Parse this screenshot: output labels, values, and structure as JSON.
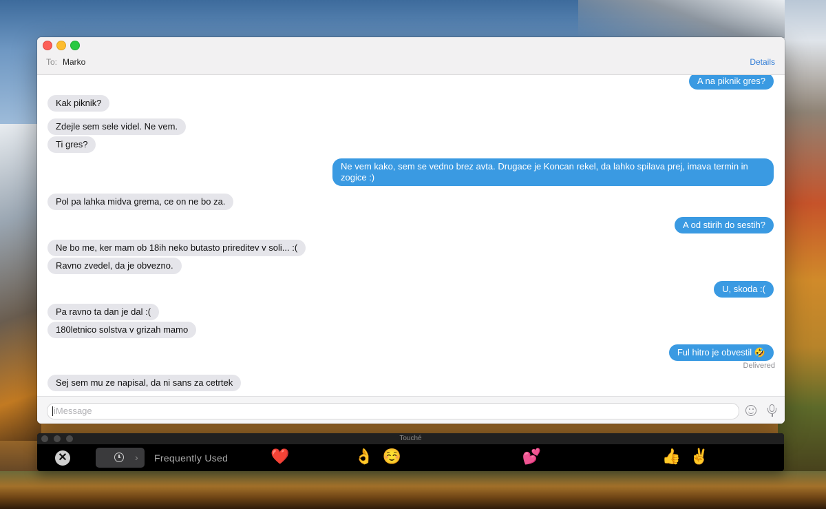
{
  "messages_window": {
    "to_label": "To:",
    "recipient": "Marko",
    "details_label": "Details",
    "composer_placeholder": "iMessage"
  },
  "conversation": [
    {
      "dir": "out",
      "text": "A na piknik gres?"
    },
    {
      "dir": "in",
      "text": "Kak piknik?"
    },
    {
      "dir": "in",
      "text": "Zdejle sem sele videl. Ne vem."
    },
    {
      "dir": "in",
      "text": "Ti gres?"
    },
    {
      "dir": "out",
      "text": "Ne vem kako, sem se vedno brez avta. Drugace je Koncan rekel, da lahko spilava prej, imava termin in zogice :)"
    },
    {
      "dir": "in",
      "text": "Pol pa lahka midva grema, ce on ne bo za."
    },
    {
      "dir": "out",
      "text": "A od stirih do sestih?"
    },
    {
      "dir": "in",
      "text": "Ne bo me, ker mam ob 18ih neko butasto prireditev v soli... :("
    },
    {
      "dir": "in",
      "text": "Ravno zvedel, da je obvezno."
    },
    {
      "dir": "out",
      "text": "U, skoda :("
    },
    {
      "dir": "in",
      "text": "Pa ravno ta dan je dal :("
    },
    {
      "dir": "in",
      "text": "180letnico solstva v grizah mamo"
    },
    {
      "dir": "out",
      "text": "Ful hitro je obvestil 🤣"
    },
    {
      "dir": "in",
      "text": "Sej sem mu ze napisal, da ni sans za cetrtek"
    }
  ],
  "delivered_label": "Delivered",
  "touche": {
    "title": "Touché",
    "close_label": "✕",
    "category_label": "Frequently Used",
    "emojis": [
      "😂",
      "❤️",
      "😍",
      "😒",
      "👌",
      "☺️",
      "😊",
      "😘",
      "😭",
      "😩",
      "💕",
      "😔",
      "😏",
      "😁",
      "😳",
      "👍",
      "✌️",
      "😉",
      "😌"
    ]
  },
  "icons": {
    "clock": "clock-icon",
    "chevron": "chevron-right-icon",
    "emoji_picker": "smiley-icon",
    "microphone": "microphone-icon"
  },
  "colors": {
    "outgoing_bubble": "#3a9ae2",
    "incoming_bubble": "#e5e5ea",
    "link": "#2f7bd6"
  }
}
